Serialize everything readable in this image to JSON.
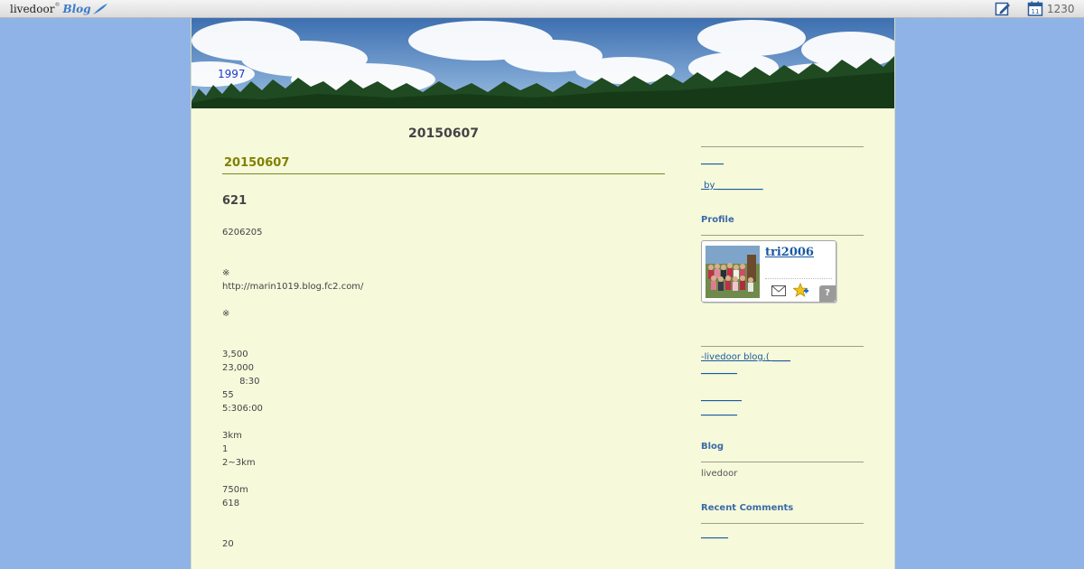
{
  "topbar": {
    "brand_name": "livedoor",
    "brand_sup": "®",
    "brand_blog": "Blog",
    "edit_icon": "edit-icon",
    "calendar_icon": "calendar-icon",
    "calendar_day": "11",
    "count": "1230"
  },
  "header": {
    "blog_title": "1997"
  },
  "main": {
    "date_heading": "20150607",
    "entry_title": "20150607",
    "entry_subtitle": "621",
    "lines": [
      "6206205",
      "※",
      "http://marin1019.blog.fc2.com/",
      "※",
      "3,500",
      "23,000",
      "      8:30",
      "55",
      "5:306:00",
      "3km",
      "1",
      "2~3km",
      "750m",
      "618",
      "20"
    ]
  },
  "sidebar": {
    "link1": "_____",
    "link2": " by __________",
    "profile_heading": "Profile",
    "profile_name": "tri2006",
    "help_label": "?",
    "mail_icon": "mail-icon",
    "star_icon": "star-add-icon",
    "link3": "-livedoor blog.( ____",
    "link4": "________",
    "link5": "_________",
    "link6": "________",
    "blog_heading": "Blog",
    "blog_text": "livedoor",
    "recent_heading": "Recent Comments",
    "link7": "______"
  },
  "colors": {
    "background": "#8fb3e6",
    "page": "#f6f9da",
    "entry_title": "#808000",
    "link": "#1a5aa0",
    "heading": "#3a6aa8"
  }
}
